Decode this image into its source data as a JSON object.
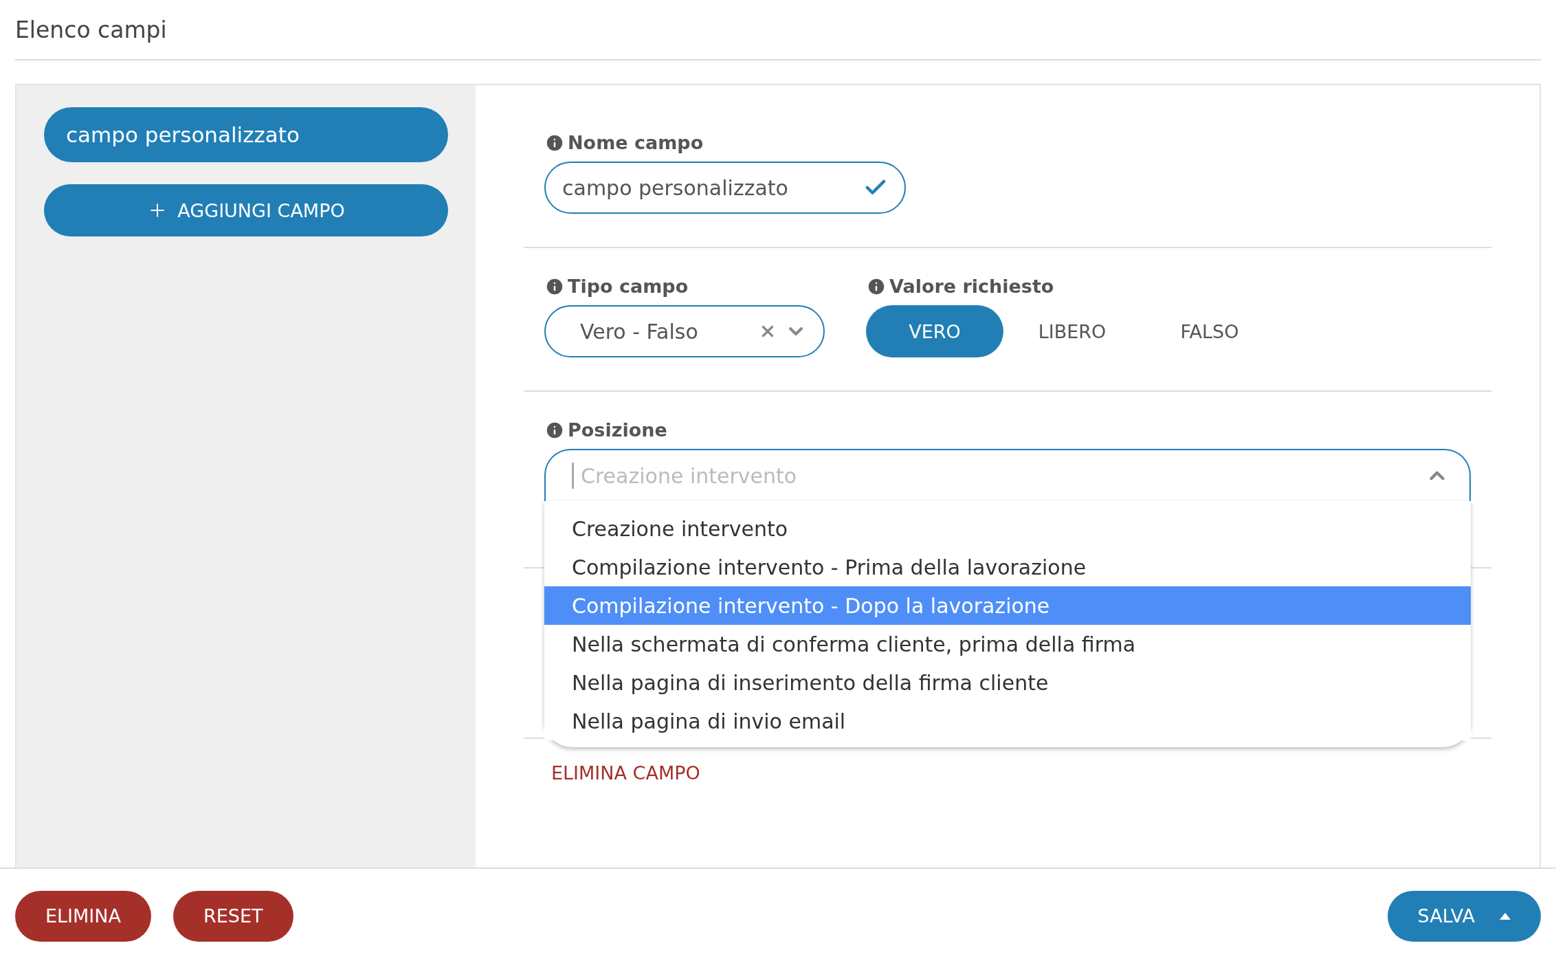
{
  "header": {
    "title": "Elenco campi"
  },
  "sidebar": {
    "fields": [
      {
        "label": "campo personalizzato",
        "selected": true
      }
    ],
    "add_button": "AGGIUNGI CAMPO"
  },
  "form": {
    "name_field": {
      "label": "Nome campo",
      "value": "campo personalizzato",
      "valid": true
    },
    "type_field": {
      "label": "Tipo campo",
      "value": "Vero - Falso"
    },
    "required_value": {
      "label": "Valore richiesto",
      "options": [
        {
          "label": "VERO",
          "selected": true
        },
        {
          "label": "LIBERO",
          "selected": false
        },
        {
          "label": "FALSO",
          "selected": false
        }
      ]
    },
    "position": {
      "label": "Posizione",
      "placeholder": "Creazione intervento",
      "expanded": true,
      "options": [
        {
          "label": "Creazione intervento",
          "selected": false
        },
        {
          "label": "Compilazione intervento - Prima della lavorazione",
          "selected": false
        },
        {
          "label": "Compilazione intervento - Dopo la lavorazione",
          "selected": true
        },
        {
          "label": "Nella schermata di conferma cliente, prima della firma",
          "selected": false
        },
        {
          "label": "Nella pagina di inserimento della firma cliente",
          "selected": false
        },
        {
          "label": "Nella pagina di invio email",
          "selected": false
        }
      ]
    },
    "delete_field_link": "ELIMINA CAMPO"
  },
  "footer": {
    "left_buttons": [
      "ELIMINA",
      "RESET"
    ],
    "save_button": "SALVA"
  }
}
